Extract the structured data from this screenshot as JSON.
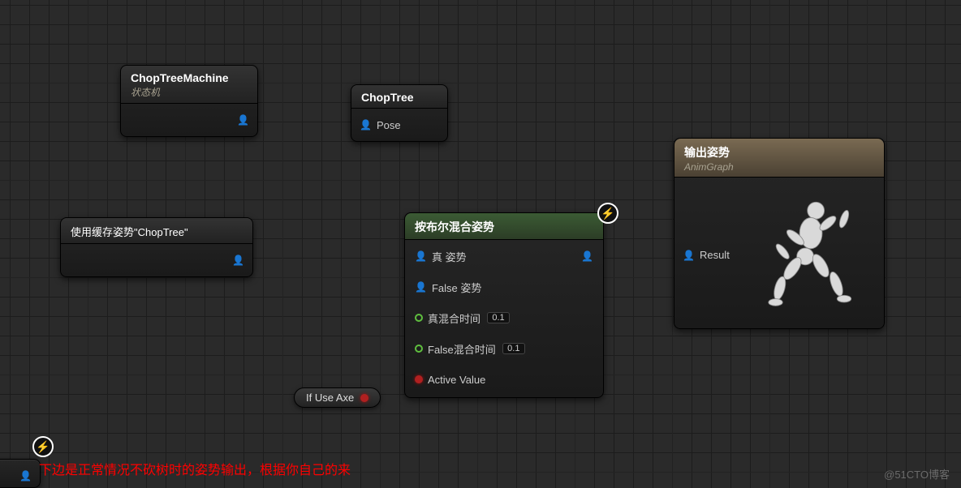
{
  "nodes": {
    "choptree_machine": {
      "title": "ChopTreeMachine",
      "subtitle": "状态机"
    },
    "choptree": {
      "title": "ChopTree",
      "pose_label": "Pose"
    },
    "cached_pose": {
      "title": "使用缓存姿势\"ChopTree\""
    },
    "blend": {
      "title": "按布尔混合姿势",
      "true_pose_label": "真 姿势",
      "false_pose_label": "False 姿势",
      "true_blend_label": "真混合时间",
      "false_blend_label": "False混合时间",
      "active_value_label": "Active Value",
      "true_blend_value": "0.1",
      "false_blend_value": "0.1"
    },
    "output": {
      "title": "输出姿势",
      "subtitle": "AnimGraph",
      "result_label": "Result"
    }
  },
  "if_use_axe": {
    "label": "If Use Axe"
  },
  "annotation": "下边是正常情况不砍树时的姿势输出，根据你自己的来",
  "watermark": "@51CTO博客"
}
